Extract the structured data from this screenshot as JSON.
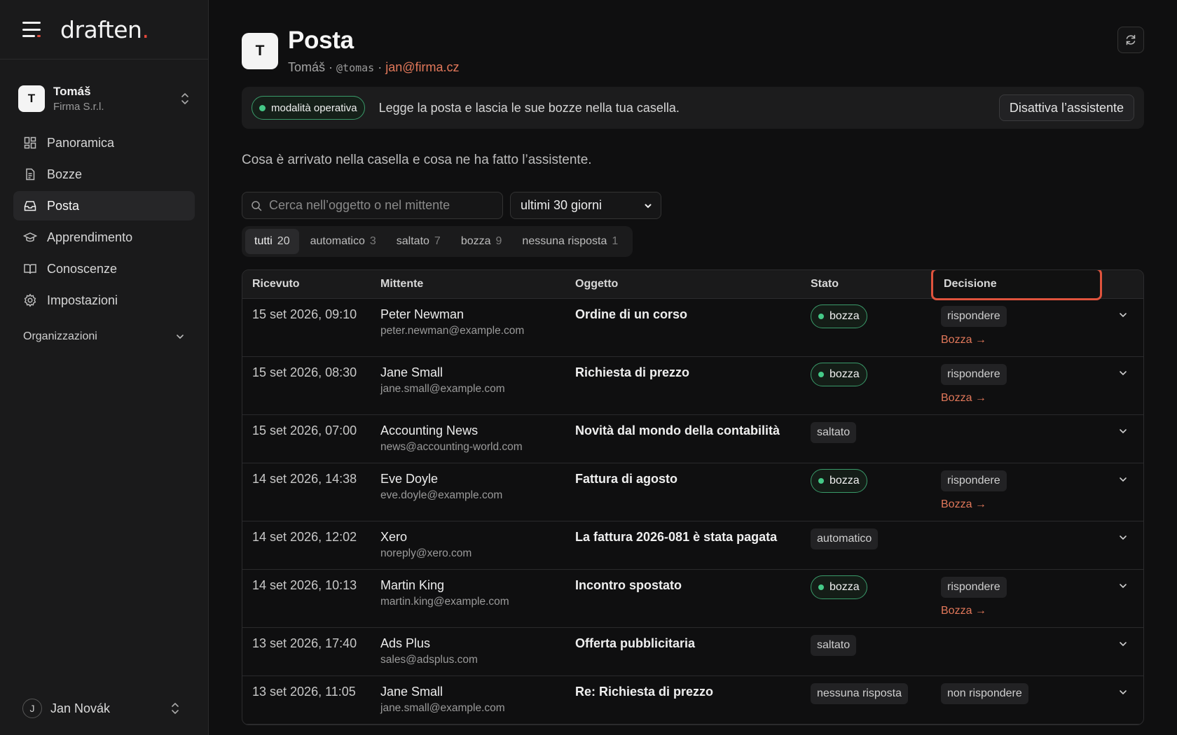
{
  "brand": {
    "name": "draften",
    "dot": "."
  },
  "org": {
    "initial": "T",
    "name": "Tomáš",
    "company": "Firma S.r.l."
  },
  "nav": [
    {
      "label": "Panoramica",
      "icon": "grid-icon"
    },
    {
      "label": "Bozze",
      "icon": "file-icon"
    },
    {
      "label": "Posta",
      "icon": "inbox-icon",
      "active": true
    },
    {
      "label": "Apprendimento",
      "icon": "graduation-cap-icon"
    },
    {
      "label": "Conoscenze",
      "icon": "book-icon"
    },
    {
      "label": "Impostazioni",
      "icon": "gear-icon"
    }
  ],
  "org_section": {
    "label": "Organizzazioni"
  },
  "user": {
    "initial": "J",
    "name": "Jan Novák"
  },
  "page": {
    "initial": "T",
    "title": "Posta",
    "owner": "Tomáš",
    "sep": " · ",
    "handle": "@tomas",
    "email": "jan@firma.cz"
  },
  "banner": {
    "mode": "modalità operativa",
    "text": "Legge la posta e lascia le sue bozze nella tua casella.",
    "button": "Disattiva l’assistente"
  },
  "description": "Cosa è arrivato nella casella e cosa ne ha fatto l’assistente.",
  "search": {
    "placeholder": "Cerca nell’oggetto o nel mittente"
  },
  "range": {
    "selected": "ultimi 30 giorni"
  },
  "tabs": [
    {
      "label": "tutti",
      "count": "20",
      "active": true
    },
    {
      "label": "automatico",
      "count": "3"
    },
    {
      "label": "saltato",
      "count": "7"
    },
    {
      "label": "bozza",
      "count": "9"
    },
    {
      "label": "nessuna risposta",
      "count": "1"
    }
  ],
  "table": {
    "headers": {
      "date": "Ricevuto",
      "from": "Mittente",
      "subject": "Oggetto",
      "state": "Stato",
      "decision": "Decisione"
    },
    "rows": [
      {
        "date": "15 set 2026, 09:10",
        "name": "Peter Newman",
        "email": "peter.newman@example.com",
        "subject": "Ordine di un corso",
        "state": "bozza",
        "decision": "rispondere",
        "link": "Bozza →"
      },
      {
        "date": "15 set 2026, 08:30",
        "name": "Jane Small",
        "email": "jane.small@example.com",
        "subject": "Richiesta di prezzo",
        "state": "bozza",
        "decision": "rispondere",
        "link": "Bozza →"
      },
      {
        "date": "15 set 2026, 07:00",
        "name": "Accounting News",
        "email": "news@accounting-world.com",
        "subject": "Novità dal mondo della contabilità",
        "state": "saltato",
        "decision": "",
        "link": ""
      },
      {
        "date": "14 set 2026, 14:38",
        "name": "Eve Doyle",
        "email": "eve.doyle@example.com",
        "subject": "Fattura di agosto",
        "state": "bozza",
        "decision": "rispondere",
        "link": "Bozza →"
      },
      {
        "date": "14 set 2026, 12:02",
        "name": "Xero",
        "email": "noreply@xero.com",
        "subject": "La fattura 2026-081 è stata pagata",
        "state": "automatico",
        "decision": "",
        "link": ""
      },
      {
        "date": "14 set 2026, 10:13",
        "name": "Martin King",
        "email": "martin.king@example.com",
        "subject": "Incontro spostato",
        "state": "bozza",
        "decision": "rispondere",
        "link": "Bozza →"
      },
      {
        "date": "13 set 2026, 17:40",
        "name": "Ads Plus",
        "email": "sales@adsplus.com",
        "subject": "Offerta pubblicitaria",
        "state": "saltato",
        "decision": "",
        "link": ""
      },
      {
        "date": "13 set 2026, 11:05",
        "name": "Jane Small",
        "email": "jane.small@example.com",
        "subject": "Re: Richiesta di prezzo",
        "state": "nessuna risposta",
        "decision": "non rispondere",
        "link": ""
      }
    ]
  },
  "colors": {
    "accent": "#e2785a",
    "green": "#45c987",
    "highlight": "#e0533d"
  }
}
